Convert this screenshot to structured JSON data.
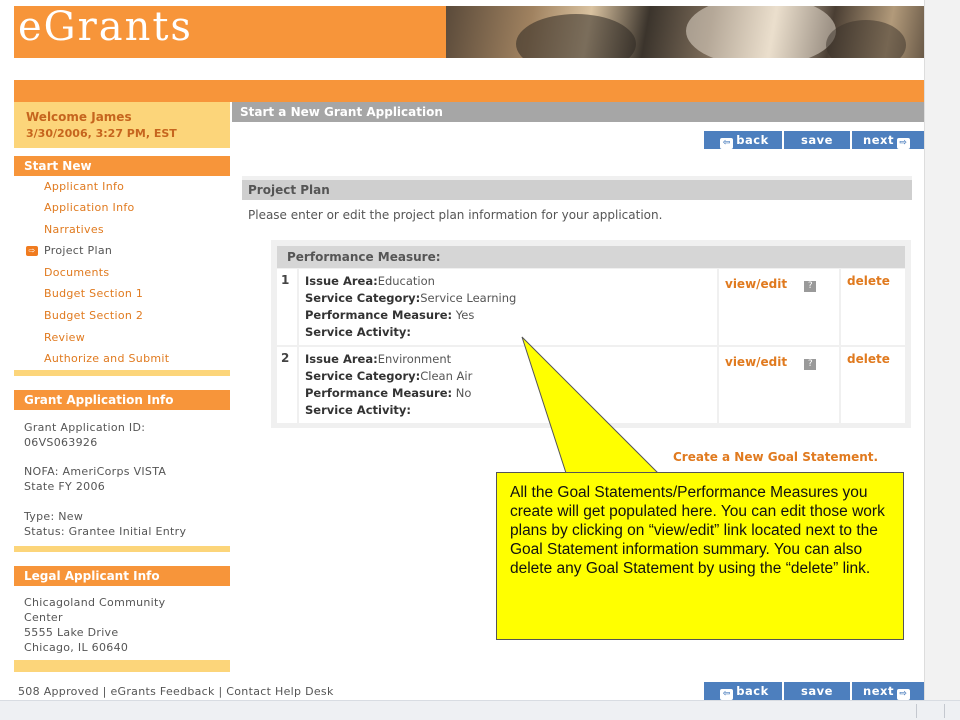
{
  "header": {
    "logo_text": "eGrants"
  },
  "sidebar": {
    "welcome": "Welcome James",
    "datetime": "3/30/2006, 3:27 PM, EST",
    "start_new_heading": "Start New",
    "nav_items": [
      {
        "label": "Applicant Info"
      },
      {
        "label": "Application Info"
      },
      {
        "label": "Narratives"
      },
      {
        "label": "Project Plan"
      },
      {
        "label": "Documents"
      },
      {
        "label": "Budget Section 1"
      },
      {
        "label": "Budget Section 2"
      },
      {
        "label": "Review"
      },
      {
        "label": "Authorize and Submit"
      }
    ],
    "active_arrow": "⇨",
    "grant_info_heading": "Grant Application Info",
    "grant_info": {
      "id_label": "Grant Application ID:",
      "id_value": "06VS063926",
      "nofa_line1": "NOFA: AmeriCorps VISTA",
      "nofa_line2": "State FY 2006",
      "type_line": "Type: New",
      "status_line": "Status: Grantee Initial Entry"
    },
    "legal_heading": "Legal Applicant Info",
    "legal": {
      "line1": "Chicagoland Community",
      "line2": "Center",
      "line3": "5555 Lake Drive",
      "line4": "Chicago, IL 60640"
    }
  },
  "main": {
    "title": "Start a New Grant Application",
    "buttons": {
      "back": "back",
      "save": "save",
      "next": "next"
    },
    "panel_title": "Project Plan",
    "panel_desc": "Please enter or edit the project plan information for your application.",
    "pm_heading": "Performance Measure:",
    "rows": [
      {
        "num": "1",
        "issue_label": "Issue Area:",
        "issue_value": "Education",
        "category_label": "Service Category:",
        "category_value": "Service Learning",
        "measure_label": "Performance Measure:",
        "measure_value": " Yes",
        "activity_label": "Service Activity:",
        "view_edit": "view/edit",
        "help": "?",
        "delete": "delete"
      },
      {
        "num": "2",
        "issue_label": "Issue Area:",
        "issue_value": "Environment",
        "category_label": "Service Category:",
        "category_value": "Clean Air",
        "measure_label": "Performance Measure:",
        "measure_value": " No",
        "activity_label": "Service Activity:",
        "view_edit": "view/edit",
        "help": "?",
        "delete": "delete"
      }
    ],
    "create_link": "Create a New Goal Statement."
  },
  "footer": {
    "links": "508 Approved  |  eGrants Feedback  |  Contact Help Desk"
  },
  "callout": {
    "text": "All the Goal Statements/Performance Measures you create will get populated here. You can edit those work plans by clicking on “view/edit” link located next to the Goal Statement information summary. You can also delete any Goal Statement by using the “delete” link."
  },
  "colors": {
    "orange": "#f7953a",
    "light_orange": "#fcd57a",
    "link_orange": "#e07a1f",
    "button_blue": "#4d7fbe",
    "callout_yellow": "#ffff00"
  },
  "icons": {
    "back": "arrow-left-icon",
    "next": "arrow-right-icon",
    "help": "help-icon",
    "active": "arrow-right-icon"
  }
}
